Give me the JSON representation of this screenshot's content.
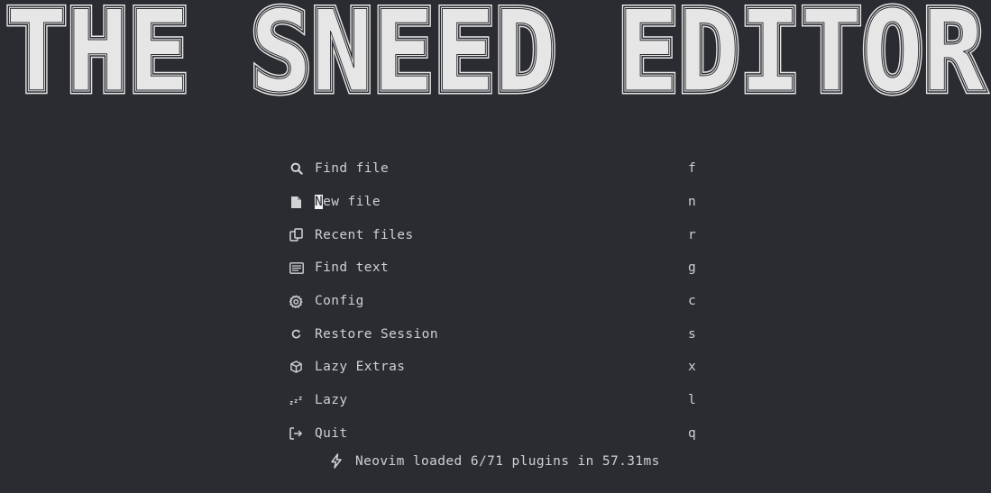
{
  "banner": {
    "title": "THE SNEED EDITOR"
  },
  "menu": {
    "items": [
      {
        "icon": "search-icon",
        "label": "Find file",
        "key": "f"
      },
      {
        "icon": "file-icon",
        "label": "New file",
        "key": "n"
      },
      {
        "icon": "files-icon",
        "label": "Recent files",
        "key": "r"
      },
      {
        "icon": "text-search-icon",
        "label": "Find text",
        "key": "g"
      },
      {
        "icon": "gear-icon",
        "label": "Config",
        "key": "c"
      },
      {
        "icon": "restore-icon",
        "label": "Restore Session",
        "key": "s"
      },
      {
        "icon": "package-icon",
        "label": "Lazy Extras",
        "key": "x"
      },
      {
        "icon": "sleep-icon",
        "label": "Lazy",
        "key": "l"
      },
      {
        "icon": "logout-icon",
        "label": "Quit",
        "key": "q"
      }
    ]
  },
  "footer": {
    "icon": "lightning-icon",
    "text": "Neovim loaded 6/71 plugins in 57.31ms"
  },
  "colors": {
    "background": "#2b2c31",
    "text": "#cfd0d2",
    "banner": "#e6e6e6"
  }
}
